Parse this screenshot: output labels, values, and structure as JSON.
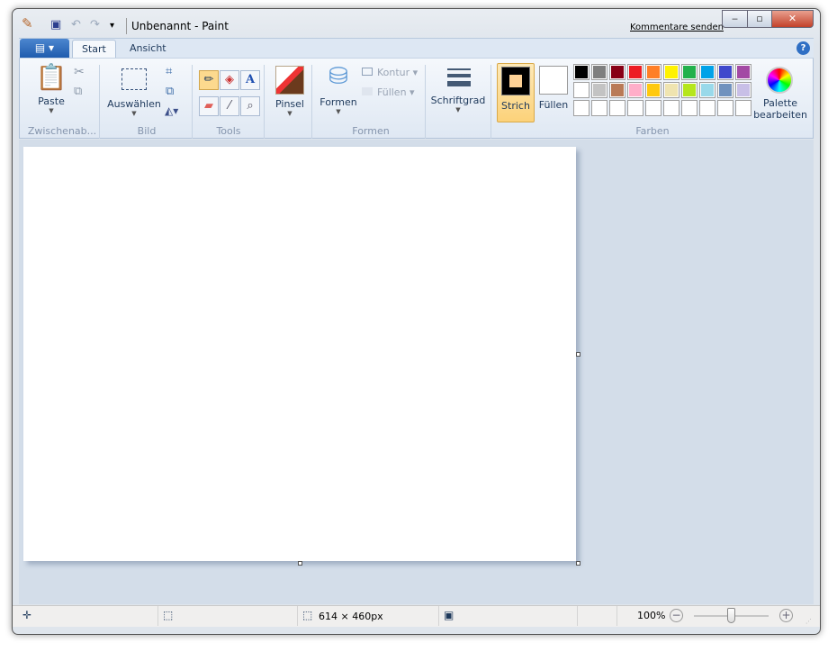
{
  "window": {
    "title": "Unbenannt - Paint",
    "feedback_link": "Kommentare senden",
    "minimize": "‒",
    "maximize": "▫",
    "close": "✕"
  },
  "qat": {
    "app_icon": "paint-icon",
    "save": "save-icon",
    "undo": "undo-icon",
    "redo": "redo-icon",
    "customize": "▾"
  },
  "tabs": [
    {
      "label": "Start",
      "active": true
    },
    {
      "label": "Ansicht",
      "active": false
    }
  ],
  "ribbon": {
    "clipboard": {
      "group": "Zwischenab...",
      "paste": "Paste"
    },
    "image": {
      "group": "Bild",
      "select": "Auswählen"
    },
    "tools": {
      "group": "Tools"
    },
    "brushes": {
      "label": "Pinsel"
    },
    "shapes": {
      "group": "Formen",
      "shapes": "Formen",
      "outline": "Kontur",
      "fill": "Füllen"
    },
    "size": {
      "label": "Schriftgrad"
    },
    "colors": {
      "group": "Farben",
      "color1": "Strich",
      "color2": "Füllen",
      "edit": "Palette bearbeiten",
      "color1_hex": "#000000",
      "color2_hex": "#ffffff",
      "palette": [
        "#000000",
        "#7f7f7f",
        "#880015",
        "#ed1c24",
        "#ff7f27",
        "#fff200",
        "#22b14c",
        "#00a2e8",
        "#3f48cc",
        "#a349a4",
        "#ffffff",
        "#c3c3c3",
        "#b97a57",
        "#ffaec9",
        "#ffc90e",
        "#efe4b0",
        "#b5e61d",
        "#99d9ea",
        "#7092be",
        "#c8bfe7",
        "#ffffff",
        "#ffffff",
        "#ffffff",
        "#ffffff",
        "#ffffff",
        "#ffffff",
        "#ffffff",
        "#ffffff",
        "#ffffff",
        "#ffffff"
      ]
    }
  },
  "status": {
    "canvas_size": "614 × 460px",
    "zoom": "100%",
    "zoom_level": 100
  }
}
